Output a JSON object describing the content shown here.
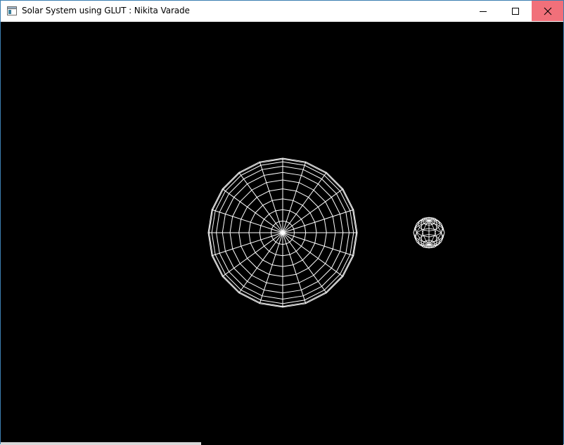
{
  "window": {
    "title": "Solar System using GLUT : Nikita Varade",
    "icon": "app-window-icon",
    "controls": {
      "minimize": "minimize-icon",
      "maximize": "maximize-icon",
      "close": "close-icon"
    }
  },
  "scene": {
    "background": "#000000",
    "wire_color": "#ffffff",
    "bodies": [
      {
        "name": "sun",
        "render": "wireframe-sphere"
      },
      {
        "name": "planet",
        "render": "wireframe-sphere"
      }
    ]
  },
  "colors": {
    "close_hover": "#f1707a",
    "border": "#3c7fb1"
  }
}
